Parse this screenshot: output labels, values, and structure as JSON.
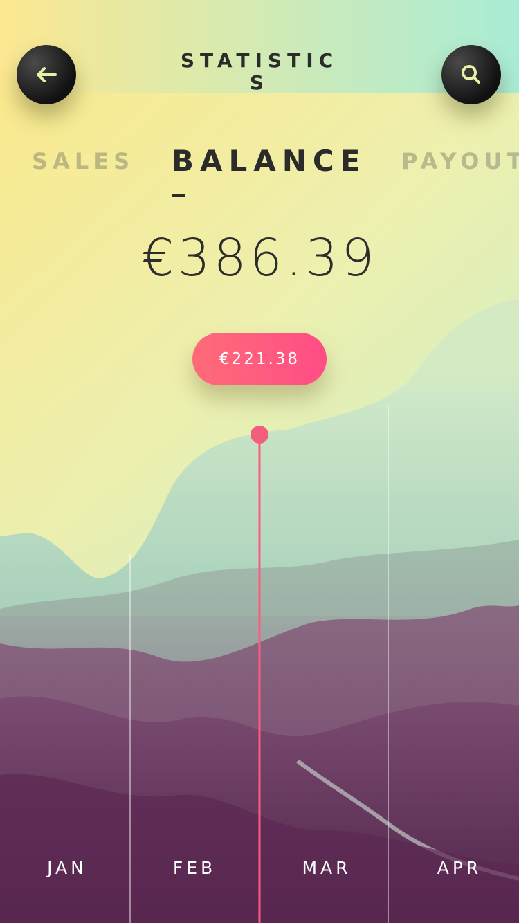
{
  "header": {
    "title": "STATISTICS",
    "back_icon": "arrow-left-icon",
    "search_icon": "search-icon"
  },
  "tabs": [
    {
      "label": "SALES",
      "active": false
    },
    {
      "label": "BALANCE",
      "active": true
    },
    {
      "label": "PAYOUT",
      "active": false
    }
  ],
  "balance": {
    "amount": "€386.39"
  },
  "tooltip": {
    "value": "€221.38"
  },
  "chart_data": {
    "type": "area",
    "categories": [
      "JAN",
      "FEB",
      "MAR",
      "APR"
    ],
    "selected_value": "€221.38"
  },
  "months": [
    "JAN",
    "FEB",
    "MAR",
    "APR"
  ],
  "colors": {
    "accent": "#ff5a80",
    "text_dark": "#2b2b2b",
    "button_bg": "#111111",
    "icon_color": "#e9f0a8"
  }
}
